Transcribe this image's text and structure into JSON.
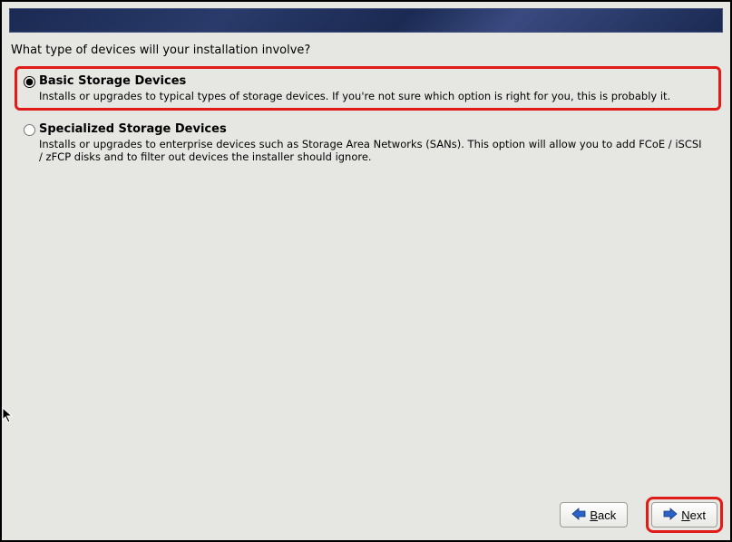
{
  "prompt": "What type of devices will your installation involve?",
  "options": {
    "basic": {
      "title": "Basic Storage Devices",
      "desc": "Installs or upgrades to typical types of storage devices.  If you're not sure which option is right for you, this is probably it.",
      "selected": true,
      "highlighted": true
    },
    "specialized": {
      "title": "Specialized Storage Devices",
      "desc": "Installs or upgrades to enterprise devices such as Storage Area Networks (SANs). This option will allow you to add FCoE / iSCSI / zFCP disks and to filter out devices the installer should ignore.",
      "selected": false,
      "highlighted": false
    }
  },
  "buttons": {
    "back": {
      "mnemonic": "B",
      "rest": "ack",
      "highlighted": false
    },
    "next": {
      "mnemonic": "N",
      "rest": "ext",
      "highlighted": true
    }
  }
}
